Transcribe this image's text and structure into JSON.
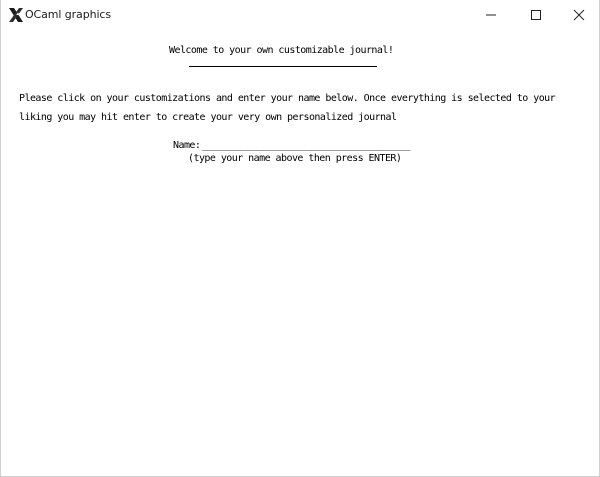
{
  "window": {
    "title": "OCaml graphics",
    "icon": "ocaml-x-icon",
    "controls": {
      "minimize": "minimize-icon",
      "maximize": "maximize-icon",
      "close": "close-icon"
    }
  },
  "journal": {
    "heading": "Welcome to your own customizable journal!",
    "instructions_line1": "Please click on your customizations and enter your name below. Once everything is selected to your",
    "instructions_line2": "liking you may hit enter to create your very own personalized journal",
    "name_label": "Name:",
    "name_field": "______________________________________",
    "name_hint": "(type your name above then press ENTER)"
  }
}
